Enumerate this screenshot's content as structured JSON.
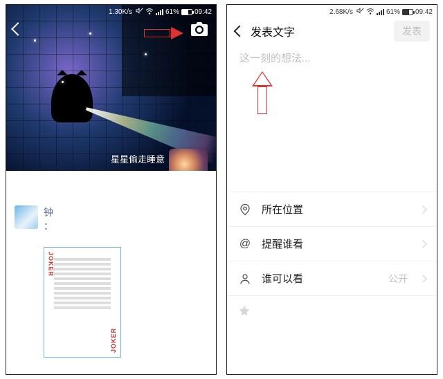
{
  "left": {
    "status": {
      "speed": "1.30K/s",
      "battery": "61%",
      "time": "09:42"
    },
    "cover_caption": "星星偷走睡意",
    "post": {
      "name": "钟",
      "colon": "："
    },
    "card": {
      "joker_top": "JOKER",
      "joker_bottom": "JOKER"
    }
  },
  "right": {
    "status": {
      "speed": "2.68K/s",
      "battery": "61%",
      "time": "09:42"
    },
    "title": "发表文字",
    "publish": "发表",
    "placeholder": "这一刻的想法...",
    "options": {
      "location": "所在位置",
      "mention": "提醒谁看",
      "visibility_label": "谁可以看",
      "visibility_value": "公开"
    }
  }
}
